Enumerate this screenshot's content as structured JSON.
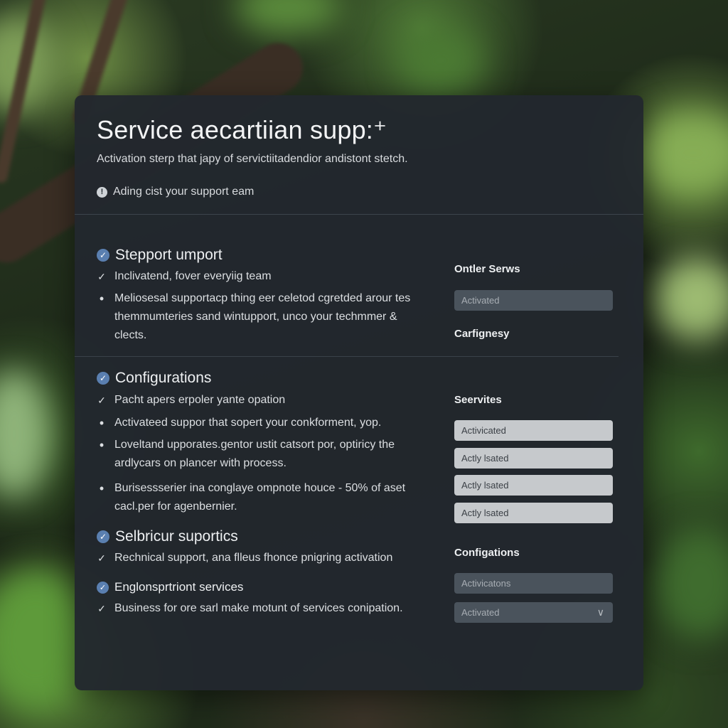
{
  "panel": {
    "title": "Service aecartiian supp:⁺",
    "subtitle": "Activation sterp that japy of servictiitadendior andistont stetch.",
    "notice": "Ading cist your support eam"
  },
  "sections": [
    {
      "heading": "Stepport umport",
      "items": [
        {
          "marker": "check",
          "text": "Inclivatend, fover everyiig team"
        },
        {
          "marker": "bullet",
          "text": "Meliosesal supportacp thing eer celetod cgretded arour tes themmumteries sand wintupport, unco your techmmer & clects."
        }
      ]
    },
    {
      "heading": "Configurations",
      "items": [
        {
          "marker": "check",
          "text": "Pacht apers erpoler yante opation"
        },
        {
          "marker": "bullet",
          "text": "Activateed suppor that sopert your conkforment, yop."
        },
        {
          "marker": "bullet",
          "text": "Loveltand upporates.gentor ustit catsort por, optiricy the ardlycars on plancer with process."
        },
        {
          "marker": "bullet",
          "text": "Burisessserier ina conglaye ompnote houce - 50% of aset cacl.per for agenbernier."
        }
      ]
    },
    {
      "heading": "Selbricur suportics",
      "items": [
        {
          "marker": "check",
          "text": "Rechnical support, ana flleus fhonce pnigring activation"
        }
      ]
    },
    {
      "heading": "Englonsprtriont services",
      "items": [
        {
          "marker": "check",
          "text": "Business for ore sarl make motunt of services conipation."
        }
      ]
    }
  ],
  "sidebar": {
    "group1_label": "Ontler Serws",
    "group1_field": "Activated",
    "group2_label": "Carfignesy",
    "group3_label": "Seervites",
    "group3_fields": [
      "Activicated",
      "Actly lsated",
      "Actly lsated",
      "Actly lsated"
    ],
    "group4_label": "Configations",
    "group4_field": "Activicatons",
    "select_value": "Activated"
  },
  "colors": {
    "panel_bg": "#22282e",
    "accent_badge": "#5a7fb0",
    "field_dark": "#4a535c",
    "field_light": "#c6c9cc"
  },
  "icons": {
    "notice": "info-circle-icon",
    "section": "check-circle-icon",
    "item_check": "checkmark-icon",
    "item_bullet": "bullet-icon",
    "select": "chevron-down-icon"
  }
}
